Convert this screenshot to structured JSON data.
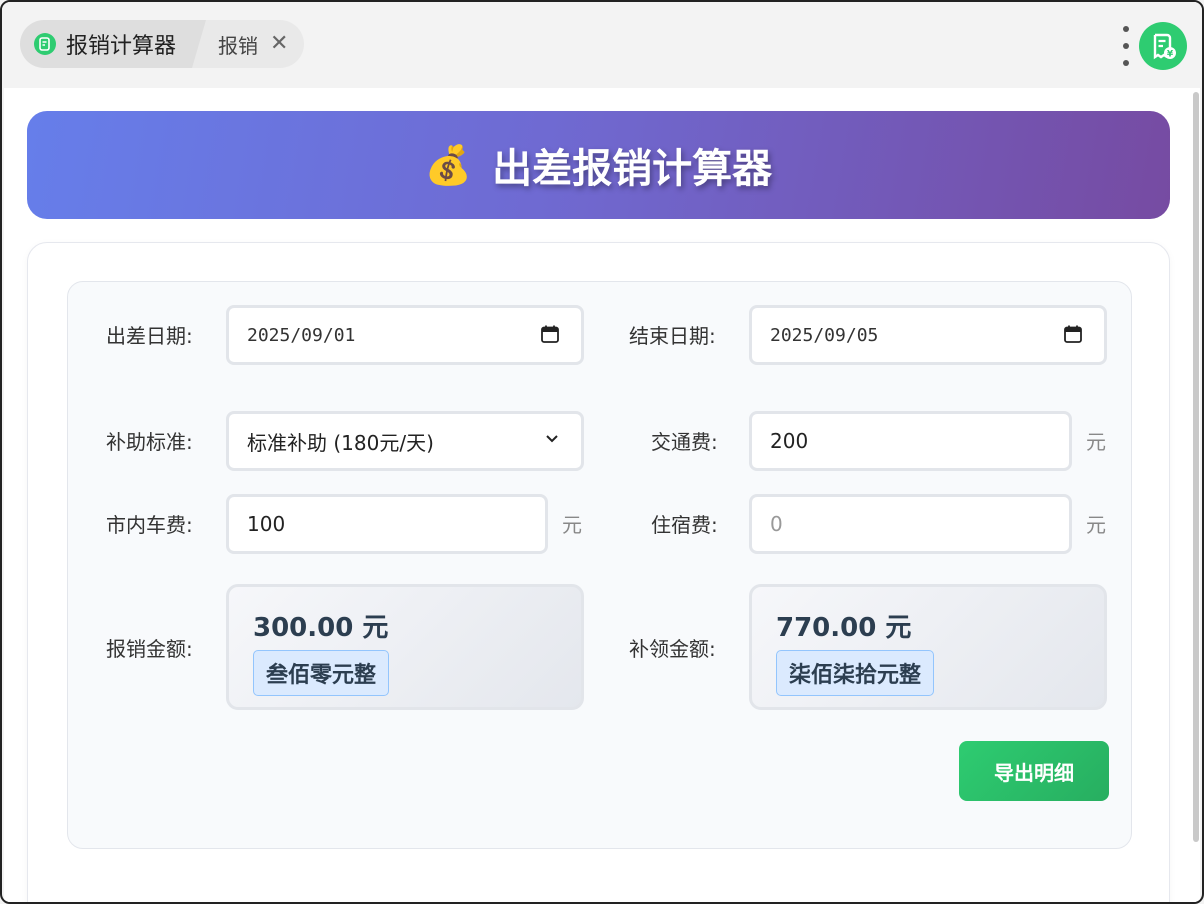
{
  "tabs": {
    "main_label": "报销计算器",
    "sub_label": "报销",
    "close_symbol": "✕"
  },
  "hero": {
    "icon": "💰",
    "title": "出差报销计算器"
  },
  "form": {
    "start_date": {
      "label": "出差日期:",
      "value": "2025/09/01"
    },
    "end_date": {
      "label": "结束日期:",
      "value": "2025/09/05"
    },
    "subsidy": {
      "label": "补助标准:",
      "value": "标准补助 (180元/天)"
    },
    "transport": {
      "label": "交通费:",
      "value": "200",
      "unit": "元"
    },
    "local_transport": {
      "label": "市内车费:",
      "value": "100",
      "unit": "元"
    },
    "lodging": {
      "label": "住宿费:",
      "placeholder": "0",
      "unit": "元"
    }
  },
  "results": {
    "reimburse": {
      "label": "报销金额:",
      "amount": "300.00 元",
      "chinese": "叁佰零元整"
    },
    "supplement": {
      "label": "补领金额:",
      "amount": "770.00 元",
      "chinese": "柒佰柒拾元整"
    }
  },
  "export_label": "导出明细",
  "colors": {
    "accent_green": "#2ecc71",
    "hero_start": "#667eea",
    "hero_end": "#764ba2"
  }
}
